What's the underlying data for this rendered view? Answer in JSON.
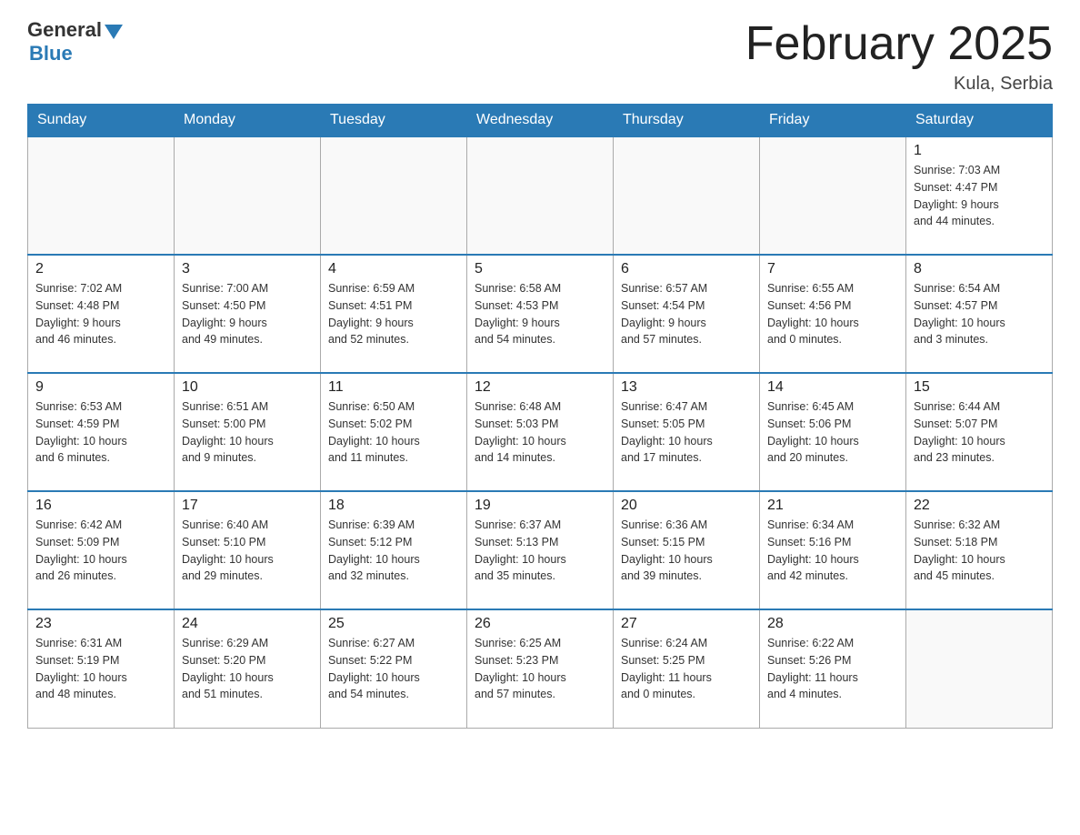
{
  "logo": {
    "general": "General",
    "blue": "Blue"
  },
  "header": {
    "title": "February 2025",
    "location": "Kula, Serbia"
  },
  "weekdays": [
    "Sunday",
    "Monday",
    "Tuesday",
    "Wednesday",
    "Thursday",
    "Friday",
    "Saturday"
  ],
  "weeks": [
    [
      {
        "day": "",
        "info": ""
      },
      {
        "day": "",
        "info": ""
      },
      {
        "day": "",
        "info": ""
      },
      {
        "day": "",
        "info": ""
      },
      {
        "day": "",
        "info": ""
      },
      {
        "day": "",
        "info": ""
      },
      {
        "day": "1",
        "info": "Sunrise: 7:03 AM\nSunset: 4:47 PM\nDaylight: 9 hours\nand 44 minutes."
      }
    ],
    [
      {
        "day": "2",
        "info": "Sunrise: 7:02 AM\nSunset: 4:48 PM\nDaylight: 9 hours\nand 46 minutes."
      },
      {
        "day": "3",
        "info": "Sunrise: 7:00 AM\nSunset: 4:50 PM\nDaylight: 9 hours\nand 49 minutes."
      },
      {
        "day": "4",
        "info": "Sunrise: 6:59 AM\nSunset: 4:51 PM\nDaylight: 9 hours\nand 52 minutes."
      },
      {
        "day": "5",
        "info": "Sunrise: 6:58 AM\nSunset: 4:53 PM\nDaylight: 9 hours\nand 54 minutes."
      },
      {
        "day": "6",
        "info": "Sunrise: 6:57 AM\nSunset: 4:54 PM\nDaylight: 9 hours\nand 57 minutes."
      },
      {
        "day": "7",
        "info": "Sunrise: 6:55 AM\nSunset: 4:56 PM\nDaylight: 10 hours\nand 0 minutes."
      },
      {
        "day": "8",
        "info": "Sunrise: 6:54 AM\nSunset: 4:57 PM\nDaylight: 10 hours\nand 3 minutes."
      }
    ],
    [
      {
        "day": "9",
        "info": "Sunrise: 6:53 AM\nSunset: 4:59 PM\nDaylight: 10 hours\nand 6 minutes."
      },
      {
        "day": "10",
        "info": "Sunrise: 6:51 AM\nSunset: 5:00 PM\nDaylight: 10 hours\nand 9 minutes."
      },
      {
        "day": "11",
        "info": "Sunrise: 6:50 AM\nSunset: 5:02 PM\nDaylight: 10 hours\nand 11 minutes."
      },
      {
        "day": "12",
        "info": "Sunrise: 6:48 AM\nSunset: 5:03 PM\nDaylight: 10 hours\nand 14 minutes."
      },
      {
        "day": "13",
        "info": "Sunrise: 6:47 AM\nSunset: 5:05 PM\nDaylight: 10 hours\nand 17 minutes."
      },
      {
        "day": "14",
        "info": "Sunrise: 6:45 AM\nSunset: 5:06 PM\nDaylight: 10 hours\nand 20 minutes."
      },
      {
        "day": "15",
        "info": "Sunrise: 6:44 AM\nSunset: 5:07 PM\nDaylight: 10 hours\nand 23 minutes."
      }
    ],
    [
      {
        "day": "16",
        "info": "Sunrise: 6:42 AM\nSunset: 5:09 PM\nDaylight: 10 hours\nand 26 minutes."
      },
      {
        "day": "17",
        "info": "Sunrise: 6:40 AM\nSunset: 5:10 PM\nDaylight: 10 hours\nand 29 minutes."
      },
      {
        "day": "18",
        "info": "Sunrise: 6:39 AM\nSunset: 5:12 PM\nDaylight: 10 hours\nand 32 minutes."
      },
      {
        "day": "19",
        "info": "Sunrise: 6:37 AM\nSunset: 5:13 PM\nDaylight: 10 hours\nand 35 minutes."
      },
      {
        "day": "20",
        "info": "Sunrise: 6:36 AM\nSunset: 5:15 PM\nDaylight: 10 hours\nand 39 minutes."
      },
      {
        "day": "21",
        "info": "Sunrise: 6:34 AM\nSunset: 5:16 PM\nDaylight: 10 hours\nand 42 minutes."
      },
      {
        "day": "22",
        "info": "Sunrise: 6:32 AM\nSunset: 5:18 PM\nDaylight: 10 hours\nand 45 minutes."
      }
    ],
    [
      {
        "day": "23",
        "info": "Sunrise: 6:31 AM\nSunset: 5:19 PM\nDaylight: 10 hours\nand 48 minutes."
      },
      {
        "day": "24",
        "info": "Sunrise: 6:29 AM\nSunset: 5:20 PM\nDaylight: 10 hours\nand 51 minutes."
      },
      {
        "day": "25",
        "info": "Sunrise: 6:27 AM\nSunset: 5:22 PM\nDaylight: 10 hours\nand 54 minutes."
      },
      {
        "day": "26",
        "info": "Sunrise: 6:25 AM\nSunset: 5:23 PM\nDaylight: 10 hours\nand 57 minutes."
      },
      {
        "day": "27",
        "info": "Sunrise: 6:24 AM\nSunset: 5:25 PM\nDaylight: 11 hours\nand 0 minutes."
      },
      {
        "day": "28",
        "info": "Sunrise: 6:22 AM\nSunset: 5:26 PM\nDaylight: 11 hours\nand 4 minutes."
      },
      {
        "day": "",
        "info": ""
      }
    ]
  ]
}
